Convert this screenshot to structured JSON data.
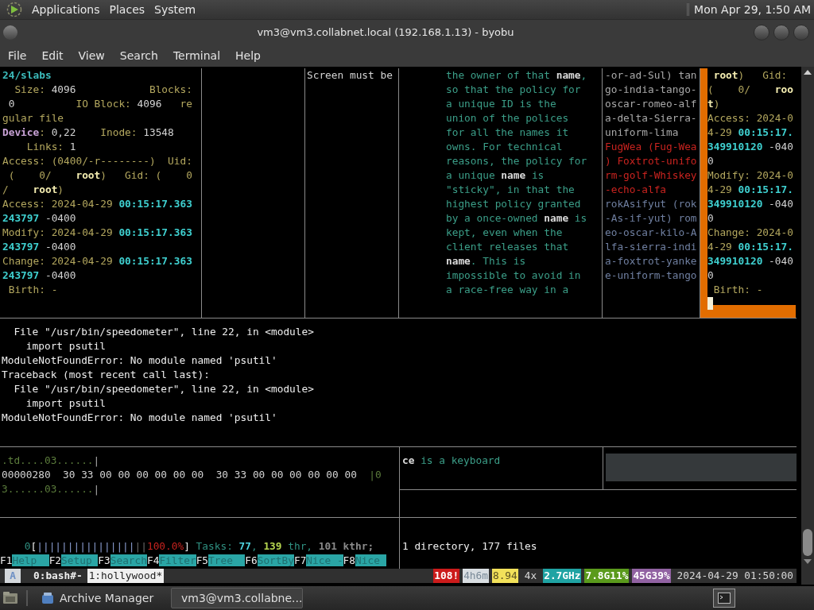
{
  "top_panel": {
    "menus": [
      "Applications",
      "Places",
      "System"
    ],
    "clock": "Mon Apr 29, 1:50 AM"
  },
  "window": {
    "title": "vm3@vm3.collabnet.local (192.168.1.13) - byobu"
  },
  "menu_bar": [
    "File",
    "Edit",
    "View",
    "Search",
    "Terminal",
    "Help"
  ],
  "terminal": {
    "top_panes": [
      {
        "selected": false,
        "lines": [
          [
            {
              "text": "24/slabs",
              "kind": "path"
            }
          ],
          [
            {
              "text": "  Size: ",
              "kind": "label"
            },
            {
              "text": "4096",
              "kind": "plain"
            },
            {
              "text": "            Blocks:",
              "kind": "label"
            }
          ],
          [
            {
              "text": " 0",
              "kind": "plain"
            },
            {
              "text": "          IO Block: ",
              "kind": "label"
            },
            {
              "text": "4096",
              "kind": "plain"
            },
            {
              "text": "   re",
              "kind": "label"
            }
          ],
          [
            {
              "text": "gular file",
              "kind": "label"
            }
          ],
          [
            {
              "text": "Device",
              "kind": "purple"
            },
            {
              "text": ": ",
              "kind": "label"
            },
            {
              "text": "0,22",
              "kind": "plain"
            },
            {
              "text": "    Inode: ",
              "kind": "label"
            },
            {
              "text": "13548",
              "kind": "plain"
            }
          ],
          [
            {
              "text": "    Links: ",
              "kind": "label"
            },
            {
              "text": "1",
              "kind": "plain"
            }
          ],
          [
            {
              "text": "Access: (0400/-r--------)  Uid:",
              "kind": "label"
            }
          ],
          [
            {
              "text": " (    0/    ",
              "kind": "label"
            },
            {
              "text": "root",
              "kind": "strong"
            },
            {
              "text": ")   Gid: (    0",
              "kind": "label"
            }
          ],
          [
            {
              "text": "/    ",
              "kind": "label"
            },
            {
              "text": "root",
              "kind": "strong"
            },
            {
              "text": ")",
              "kind": "label"
            }
          ],
          [
            {
              "text": "Access: 2024-04-29 ",
              "kind": "label"
            },
            {
              "text": "00:15:17.363",
              "kind": "time"
            }
          ],
          [
            {
              "text": "243797",
              "kind": "time"
            },
            {
              "text": " -0400",
              "kind": "plain"
            }
          ],
          [
            {
              "text": "Modify: 2024-04-29 ",
              "kind": "label"
            },
            {
              "text": "00:15:17.363",
              "kind": "time"
            }
          ],
          [
            {
              "text": "243797",
              "kind": "time"
            },
            {
              "text": " -0400",
              "kind": "plain"
            }
          ],
          [
            {
              "text": "Change: 2024-04-29 ",
              "kind": "label"
            },
            {
              "text": "00:15:17.363",
              "kind": "time"
            }
          ],
          [
            {
              "text": "243797",
              "kind": "time"
            },
            {
              "text": " -0400",
              "kind": "plain"
            }
          ],
          [
            {
              "text": " Birth: -",
              "kind": "label"
            }
          ]
        ]
      },
      {
        "selected": false
      },
      {
        "selected": false,
        "lines": [
          [
            {
              "text": "Screen must be",
              "kind": "plain"
            }
          ]
        ]
      },
      {
        "selected": false,
        "lines": [
          [
            {
              "text": "the owner of that ",
              "kind": "prose"
            },
            {
              "text": "name",
              "kind": "bold"
            },
            {
              "text": ",",
              "kind": "prose"
            }
          ],
          [
            {
              "text": "so that the policy for",
              "kind": "prose"
            }
          ],
          [
            {
              "text": "a unique ID is the",
              "kind": "prose"
            }
          ],
          [
            {
              "text": "union of the polices",
              "kind": "prose"
            }
          ],
          [
            {
              "text": "for all the names it",
              "kind": "prose"
            }
          ],
          [
            {
              "text": "owns. For technical",
              "kind": "prose"
            }
          ],
          [
            {
              "text": "reasons, the policy for",
              "kind": "prose"
            }
          ],
          [
            {
              "text": "a unique ",
              "kind": "prose"
            },
            {
              "text": "name",
              "kind": "bold"
            },
            {
              "text": " is",
              "kind": "prose"
            }
          ],
          [
            {
              "text": "\"sticky\", in that the",
              "kind": "prose"
            }
          ],
          [
            {
              "text": "highest policy granted",
              "kind": "prose"
            }
          ],
          [
            {
              "text": "by a once-owned ",
              "kind": "prose"
            },
            {
              "text": "name",
              "kind": "bold"
            },
            {
              "text": " is",
              "kind": "prose"
            }
          ],
          [
            {
              "text": "kept, even when the",
              "kind": "prose"
            }
          ],
          [
            {
              "text": "client releases that",
              "kind": "prose"
            }
          ],
          [
            {
              "text": "name",
              "kind": "bold"
            },
            {
              "text": ". This is",
              "kind": "prose"
            }
          ],
          [
            {
              "text": "impossible to avoid in",
              "kind": "prose"
            }
          ],
          [
            {
              "text": "a race-free way in a",
              "kind": "prose"
            }
          ]
        ]
      },
      {
        "selected": false,
        "lines": [
          [
            {
              "text": "-or-ad-Sul) tan",
              "kind": "gray"
            }
          ],
          [
            {
              "text": "go-india-tango-",
              "kind": "gray"
            }
          ],
          [
            {
              "text": "oscar-romeo-alf",
              "kind": "gray"
            }
          ],
          [
            {
              "text": "a-delta-Sierra-",
              "kind": "gray"
            }
          ],
          [
            {
              "text": "uniform-lima",
              "kind": "gray"
            }
          ],
          [
            {
              "text": "FugWea (Fug-Wea",
              "kind": "red"
            }
          ],
          [
            {
              "text": ") Foxtrot-unifo",
              "kind": "red"
            }
          ],
          [
            {
              "text": "rm-golf-Whiskey",
              "kind": "red"
            }
          ],
          [
            {
              "text": "-echo-alfa",
              "kind": "red"
            }
          ],
          [
            {
              "text": "rokAsifyut (rok",
              "kind": "slate"
            }
          ],
          [
            {
              "text": "-As-if-yut) rom",
              "kind": "slate"
            }
          ],
          [
            {
              "text": "eo-oscar-kilo-A",
              "kind": "slate"
            }
          ],
          [
            {
              "text": "lfa-sierra-indi",
              "kind": "slate"
            }
          ],
          [
            {
              "text": "a-foxtrot-yanke",
              "kind": "slate"
            }
          ],
          [
            {
              "text": "e-uniform-tango",
              "kind": "slate"
            }
          ]
        ]
      },
      {
        "selected": true,
        "cursor": true,
        "lines": [
          [
            {
              "text": " root",
              "kind": "strong"
            },
            {
              "text": ")   Gid:",
              "kind": "label"
            }
          ],
          [
            {
              "text": "(    0/    ",
              "kind": "label"
            },
            {
              "text": "roo",
              "kind": "strong"
            }
          ],
          [
            {
              "text": "t",
              "kind": "strong"
            },
            {
              "text": ")",
              "kind": "label"
            }
          ],
          [
            {
              "text": "Access: 2024-0",
              "kind": "label"
            }
          ],
          [
            {
              "text": "4-29 ",
              "kind": "label"
            },
            {
              "text": "00:15:17.",
              "kind": "time"
            }
          ],
          [
            {
              "text": "349910120",
              "kind": "time"
            },
            {
              "text": " -040",
              "kind": "plain"
            }
          ],
          [
            {
              "text": "0",
              "kind": "plain"
            }
          ],
          [
            {
              "text": "Modify: 2024-0",
              "kind": "label"
            }
          ],
          [
            {
              "text": "4-29 ",
              "kind": "label"
            },
            {
              "text": "00:15:17.",
              "kind": "time"
            }
          ],
          [
            {
              "text": "349910120",
              "kind": "time"
            },
            {
              "text": " -040",
              "kind": "plain"
            }
          ],
          [
            {
              "text": "0",
              "kind": "plain"
            }
          ],
          [
            {
              "text": "Change: 2024-0",
              "kind": "label"
            }
          ],
          [
            {
              "text": "4-29 ",
              "kind": "label"
            },
            {
              "text": "00:15:17.",
              "kind": "time"
            }
          ],
          [
            {
              "text": "349910120",
              "kind": "time"
            },
            {
              "text": " -040",
              "kind": "plain"
            }
          ],
          [
            {
              "text": "0",
              "kind": "plain"
            }
          ],
          [
            {
              "text": " Birth: -",
              "kind": "label"
            }
          ]
        ]
      }
    ],
    "traceback_pane": [
      [
        {
          "text": "  File \"/usr/bin/speedometer\", line 22, in <module>",
          "kind": "white"
        }
      ],
      [
        {
          "text": "    import psutil",
          "kind": "white"
        }
      ],
      [
        {
          "text": "ModuleNotFoundError: No module named 'psutil'",
          "kind": "white"
        }
      ],
      [
        {
          "text": "Traceback (most recent call last):",
          "kind": "white"
        }
      ],
      [
        {
          "text": "  File \"/usr/bin/speedometer\", line 22, in <module>",
          "kind": "white"
        }
      ],
      [
        {
          "text": "    import psutil",
          "kind": "white"
        }
      ],
      [
        {
          "text": "ModuleNotFoundError: No module named 'psutil'",
          "kind": "white"
        }
      ]
    ],
    "hexdump_pane": [
      [
        {
          "text": ".td....03......",
          "kind": "green"
        },
        {
          "text": "|",
          "kind": "gray"
        }
      ],
      [
        {
          "text": "00000280  30 33 00 00 00 00 00 00  30 33 00 00 00 00 00 00  ",
          "kind": "plain"
        },
        {
          "text": "|0",
          "kind": "green"
        }
      ],
      [
        {
          "text": "3......03......",
          "kind": "green"
        },
        {
          "text": "|",
          "kind": "gray"
        }
      ]
    ],
    "keyboard_pane": [
      [
        {
          "text": "ce",
          "kind": "bold"
        },
        {
          "text": " is a keyboard",
          "kind": "prose"
        }
      ]
    ],
    "htop_pane": [
      [
        {
          "text": "    0",
          "kind": "teal"
        },
        {
          "text": "[",
          "kind": "white"
        },
        {
          "text": "||||||||||||||||",
          "kind": "bar"
        },
        {
          "text": "||",
          "kind": "bardim"
        },
        {
          "text": "100.0%",
          "kind": "red"
        },
        {
          "text": "]",
          "kind": "white"
        },
        {
          "text": " Tasks: ",
          "kind": "teal"
        },
        {
          "text": "77",
          "kind": "cyan"
        },
        {
          "text": ", ",
          "kind": "teal"
        },
        {
          "text": "139",
          "kind": "lime"
        },
        {
          "text": " thr, ",
          "kind": "teal"
        },
        {
          "text": "101 kthr;",
          "kind": "graybold"
        }
      ],
      [
        {
          "text": "F1",
          "kind": "white"
        },
        {
          "text": "Help  ",
          "kind": "fkey"
        },
        {
          "text": "F2",
          "kind": "white"
        },
        {
          "text": "Setup ",
          "kind": "fkey"
        },
        {
          "text": "F3",
          "kind": "white"
        },
        {
          "text": "Search",
          "kind": "fkey"
        },
        {
          "text": "F4",
          "kind": "white"
        },
        {
          "text": "Filter",
          "kind": "fkey"
        },
        {
          "text": "F5",
          "kind": "white"
        },
        {
          "text": "Tree  ",
          "kind": "fkey"
        },
        {
          "text": "F6",
          "kind": "white"
        },
        {
          "text": "SortBy",
          "kind": "fkey"
        },
        {
          "text": "F7",
          "kind": "white"
        },
        {
          "text": "Nice -",
          "kind": "fkey"
        },
        {
          "text": "F8",
          "kind": "white"
        },
        {
          "text": "Nice ",
          "kind": "fkey"
        }
      ]
    ],
    "tree_pane": [
      [
        {
          "text": "1 directory, 177 files",
          "kind": "white"
        }
      ]
    ]
  },
  "status_bar": {
    "session": "A",
    "windows": [
      {
        "label": "0:bash#-",
        "selected": false
      },
      {
        "label": "1:hollywood*",
        "selected": true
      }
    ],
    "badges": [
      {
        "text": "108!",
        "kind": "solid",
        "color": "#cc1b1b"
      },
      {
        "text": "4h6m",
        "kind": "light",
        "color": "#d9dee2"
      },
      {
        "text": "8.94",
        "kind": "warn",
        "color": "#f2e15a"
      },
      {
        "text": "4x",
        "kind": "plain"
      },
      {
        "text": "2.7GHz",
        "kind": "solid",
        "color": "#1fa3a3"
      },
      {
        "text": "7.8G11%",
        "kind": "solid",
        "color": "#5a9a1c"
      },
      {
        "text": "45G39%",
        "kind": "solid",
        "color": "#9162a2"
      },
      {
        "text": "2024-04-29 01:50:00",
        "kind": "plain"
      }
    ]
  },
  "taskbar": {
    "tasks": [
      {
        "label": "Archive Manager",
        "selected": false
      },
      {
        "label": "vm3@vm3.collabne...",
        "selected": true
      }
    ]
  }
}
